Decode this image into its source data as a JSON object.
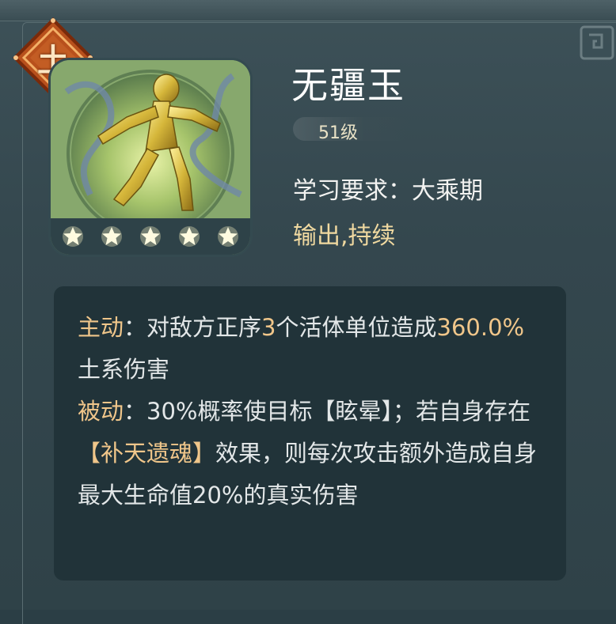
{
  "element_badge": {
    "label": "土",
    "color": "#b8501c"
  },
  "skill": {
    "name": "无疆玉",
    "level": "51级",
    "requirement": "学习要求：大乘期",
    "tags": "输出,持续",
    "stars": 5
  },
  "description": {
    "active": {
      "label": "主动",
      "sep": "：",
      "text_a": "对敌方正序",
      "num": "3",
      "text_b": "个活体单位造成",
      "value": "360.0%",
      "text_c": "土系伤害"
    },
    "passive": {
      "label": "被动",
      "sep": "：",
      "text_a": "30%概率使目标【眩晕】；若自身存在",
      "effect": "【补天遗魂】",
      "text_b": "效果，则每次攻击额外造成自身最大生命值20%的真实伤害"
    }
  },
  "colors": {
    "accent_gold": "#f0c68a",
    "tag_color": "#f0d9a0",
    "panel": "#34474e",
    "desc_box": "#213339"
  }
}
